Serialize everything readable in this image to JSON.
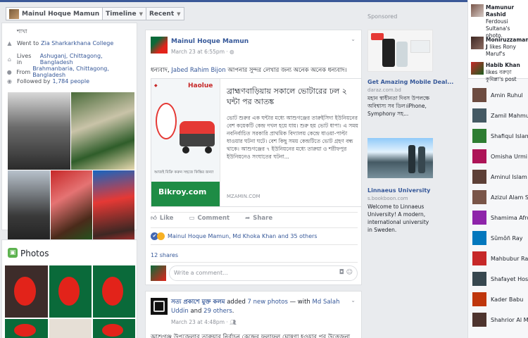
{
  "profile_bar": {
    "name": "Mainul Hoque Mamun",
    "timeline": "Timeline",
    "recent": "Recent"
  },
  "intro": {
    "cut_text": "শাখা",
    "rows": [
      {
        "icon": "graduation-cap-icon",
        "prefix": "Went to",
        "link": "Zia Sharkarkhana College"
      },
      {
        "icon": "home-icon",
        "prefix": "Lives in",
        "link": "Ashuganj, Chittagong, Bangladesh"
      },
      {
        "icon": "location-pin-icon",
        "prefix": "From",
        "link": "Brahmanbaria, Chittagong, Bangladesh"
      },
      {
        "icon": "rss-icon",
        "prefix": "Followed by",
        "link": "1,784 people"
      }
    ]
  },
  "photos": {
    "title": "Photos"
  },
  "post1": {
    "author": "Mainul Hoque Mamun",
    "meta": "March 23 at 6:55pm · ",
    "text_prefix": "ধন্যবাদ, ",
    "text_link": "Jabed Rahim Bijon",
    "text_suffix": " আপনার সুন্দর লেখার জন্য অনেক অনেক ধন্যবাদ।",
    "link": {
      "headline": "ব্রাহ্মণবাড়িয়ায় সকালে ভোটারের ঢল ২ ঘন্টা পর আতঙ্ক",
      "description": "ভোট শুরুর এক ঘন্টার মধ্যে আশুগঞ্জের তারুইসিদা ইউনিয়নের বেশ কয়েকটি কেন্দ্র দখল হয়ে যায়। শুরু হয় ভোট ধাপা। এ সময় নবনির্বাচিত সরকারি প্রাথমিক বিদ্যালয় কেন্দ্রে ধাওয়া-পাল্টা ধাওয়ার ঘটনা ঘটে। বেশ কিছু সময় কেন্দ্রটিতে ভোট গ্রহণ বন্ধ থাকে। আশুগঞ্জের ৭ ইউনিয়নের মধ্যে তারুয়া ও শরীফপুর ইউনিয়নেও সংঘাতের ঘটনা...",
      "source": "MZAMIN.COM",
      "ad_brand": "Haolue",
      "ad_tagline": "আজই বিক্রি করুন সহজে কিস্তির জন্য!",
      "ad_logo": "Bikroy.com"
    },
    "actions": {
      "like": "Like",
      "comment": "Comment",
      "share": "Share"
    },
    "reactions": "Mainul Hoque Mamun, Md Khoka Khan and 35 others",
    "shares": "12 shares",
    "comment_placeholder": "Write a comment..."
  },
  "post2": {
    "author": "সত্য প্রকাশে মুক্ত কলম",
    "action": " added ",
    "photos_link": "7 new photos",
    "with": " — with ",
    "with_name": "Md Salah Uddin",
    "and": " and ",
    "others": "29 others",
    "dot": ".",
    "meta": "March 23 at 4:48pm · ",
    "text": "আশুগঞ্জ উপজেলার তারুয়ার নির্বাচন কেন্দ্রের ফলাফল ঘোষণা হওয়ার পর উত্তেজনা"
  },
  "ads": {
    "sponsored": "Sponsored",
    "ad1": {
      "title": "Get Amazing Mobile Deal...",
      "url": "daraz.com.bd",
      "desc": "মহান স্বাধীনতা দিবস উপলক্ষে অবিশ্বাস্য সব ডিল।iPhone, Symphony সহ..."
    },
    "ad2": {
      "title": "Linnaeus University",
      "url": "s.bookboon.com",
      "desc": "Welcome to Linnaeus University! A modern, international university in Sweden."
    }
  },
  "chat": {
    "ticker": [
      {
        "name": "Mamunur Rashid",
        "rest": "Ferdousi Sultana's photo."
      },
      {
        "name": "Moniruzzaman J",
        "rest": "likes Rony Maruf's"
      },
      {
        "name": "Habib Khan",
        "rest": "likes বরুড়া কুমিল্লা's post"
      }
    ],
    "contacts": [
      "Amin Ruhul",
      "Zamil Mahmud",
      "Shafiqul Islam J",
      "Omisha Urmi",
      "Aminul Islam",
      "Azizul Alam Sho",
      "Shamima Afroz",
      "Sûmôñ Ray",
      "Mahbubur Rahm",
      "Shafayet Hossa",
      "Kader Babu",
      "Shahrior Al Mam"
    ]
  }
}
